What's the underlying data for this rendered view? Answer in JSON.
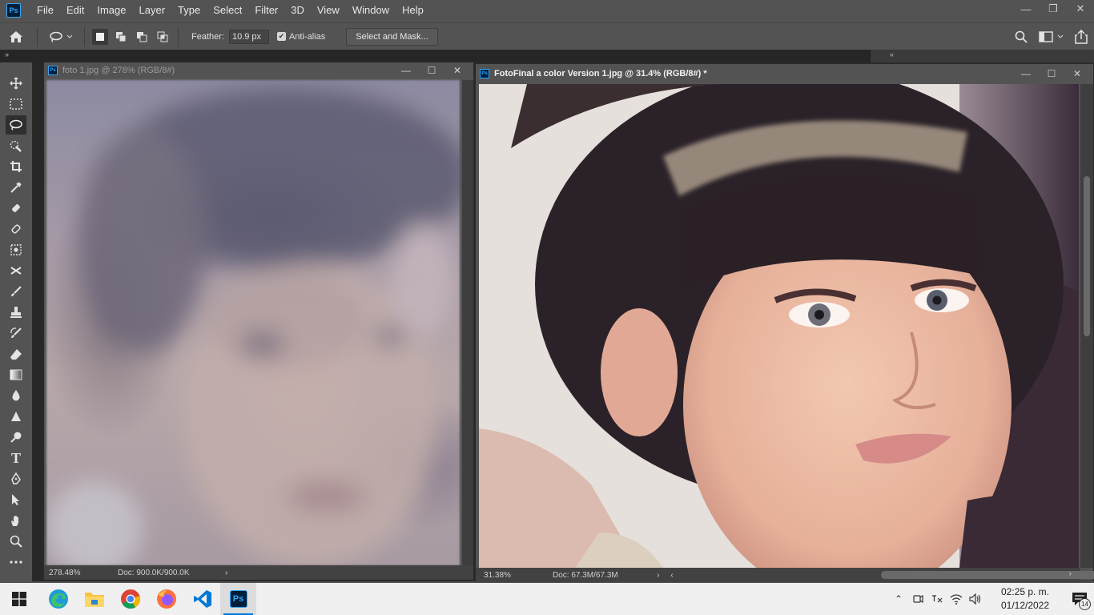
{
  "app": {
    "logo": "Ps"
  },
  "menu": [
    "File",
    "Edit",
    "Image",
    "Layer",
    "Type",
    "Select",
    "Filter",
    "3D",
    "View",
    "Window",
    "Help"
  ],
  "window_controls": {
    "minimize": "—",
    "restore": "❐",
    "close": "✕"
  },
  "options_bar": {
    "feather_label": "Feather:",
    "feather_value": "10.9 px",
    "anti_alias_label": "Anti-alias",
    "anti_alias_checked": true,
    "select_mask_label": "Select and Mask..."
  },
  "toolbar": {
    "tools": [
      "move",
      "rectangular-marquee",
      "lasso",
      "quick-selection",
      "crop",
      "eyedropper",
      "spot-healing-brush",
      "healing-brush",
      "patch",
      "content-aware-move",
      "brush",
      "clone-stamp",
      "history-brush",
      "eraser",
      "gradient",
      "blur",
      "sharpen",
      "dodge",
      "type",
      "pen",
      "path-selection",
      "hand",
      "zoom",
      "more"
    ],
    "active_tool": "lasso"
  },
  "documents": [
    {
      "title": "foto 1.jpg @ 278% (RGB/8#)",
      "active": false,
      "zoom": "278.48%",
      "doc_info": "Doc: 900.0K/900.0K"
    },
    {
      "title": "FotoFinal a color Version 1.jpg @ 31.4% (RGB/8#) *",
      "active": true,
      "zoom": "31.38%",
      "doc_info": "Doc: 67.3M/67.3M"
    }
  ],
  "taskbar": {
    "apps": [
      "edge",
      "file-explorer",
      "chrome",
      "firefox",
      "vscode",
      "photoshop"
    ],
    "active_app": "photoshop",
    "time": "02:25 p. m.",
    "date": "01/12/2022",
    "notification_count": "14"
  }
}
